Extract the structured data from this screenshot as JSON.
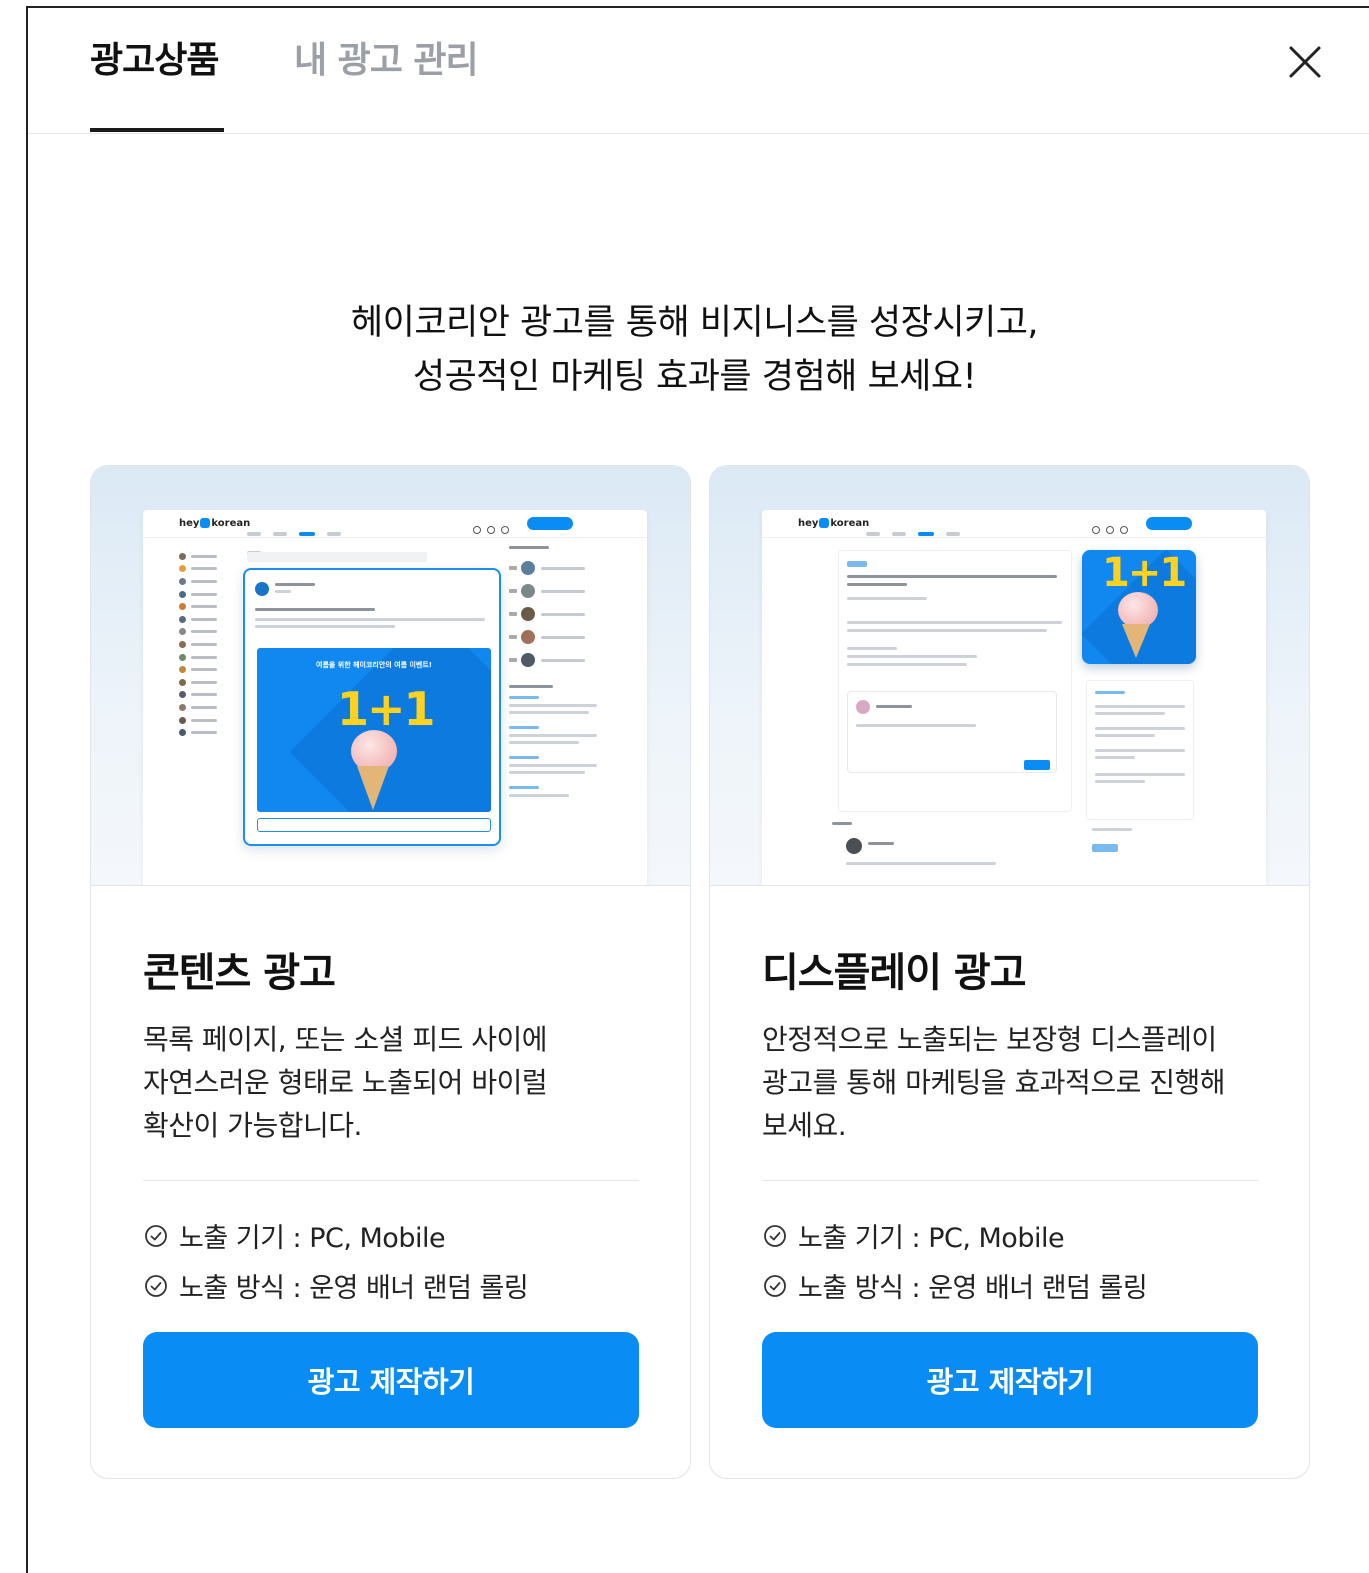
{
  "header": {
    "tabs": [
      {
        "label": "광고상품",
        "active": true
      },
      {
        "label": "내 광고 관리",
        "active": false
      }
    ]
  },
  "headline": {
    "line1": "헤이코리안 광고를 통해 비지니스를 성장시키고,",
    "line2": "성공적인 마케팅 효과를 경험해 보세요!"
  },
  "cards": [
    {
      "title": "콘텐츠 광고",
      "desc_lines": [
        "목록 페이지, 또는 소셜 피드 사이에",
        "자연스러운 형태로 노출되어 바이럴",
        "확산이 가능합니다."
      ],
      "features": [
        "노출 기기 : PC, Mobile",
        "노출 방식 : 운영 배너 랜덤 롤링"
      ],
      "cta": "광고 제작하기",
      "preview": {
        "logo": "hey korean",
        "banner_title": "여름을 위한 헤이코리안의 여름 이벤트!",
        "banner_text": "1+1"
      }
    },
    {
      "title": "디스플레이 광고",
      "desc_lines": [
        "안정적으로 노출되는 보장형 디스플레이",
        "광고를 통해 마케팅을 효과적으로 진행해",
        "보세요."
      ],
      "features": [
        "노출 기기 : PC, Mobile",
        "노출 방식 : 운영 배너 랜덤 롤링"
      ],
      "cta": "광고 제작하기",
      "preview": {
        "logo": "hey korean",
        "ad_text": "1+1"
      }
    }
  ],
  "colors": {
    "accent": "#0a8cf5",
    "tab_inactive": "#9ba0a6",
    "banner_yellow": "#ffd21f"
  }
}
